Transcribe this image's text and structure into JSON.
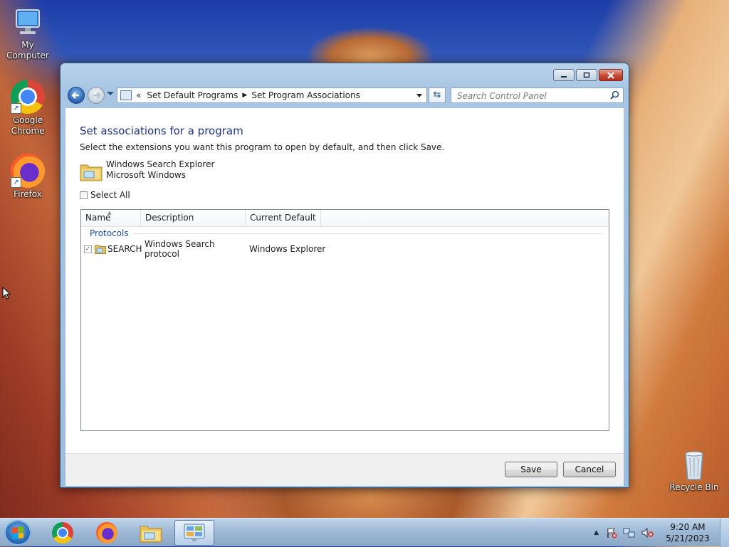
{
  "desktop": {
    "icons": [
      {
        "label": "My Computer"
      },
      {
        "label": "Google Chrome"
      },
      {
        "label": "Firefox"
      },
      {
        "label": "Recycle Bin"
      }
    ]
  },
  "window": {
    "address": {
      "overflow": "«",
      "crumbs": [
        "Set Default Programs",
        "Set Program Associations"
      ]
    },
    "search_placeholder": "Search Control Panel",
    "heading": "Set associations for a program",
    "instructions": "Select the extensions you want this program to open by default, and then click Save.",
    "program": {
      "name": "Windows Search Explorer",
      "publisher": "Microsoft Windows"
    },
    "select_all": "Select All",
    "columns": [
      "Name",
      "Description",
      "Current Default"
    ],
    "group": "Protocols",
    "rows": [
      {
        "name": "SEARCH",
        "description": "Windows Search protocol",
        "current_default": "Windows Explorer",
        "checked": true
      }
    ],
    "buttons": {
      "save": "Save",
      "cancel": "Cancel"
    }
  },
  "taskbar": {
    "clock": {
      "time": "9:20 AM",
      "date": "5/21/2023"
    }
  },
  "colors": {
    "heading": "#1e3287",
    "group": "#1e4ea0",
    "close_button": "#c74a35"
  }
}
